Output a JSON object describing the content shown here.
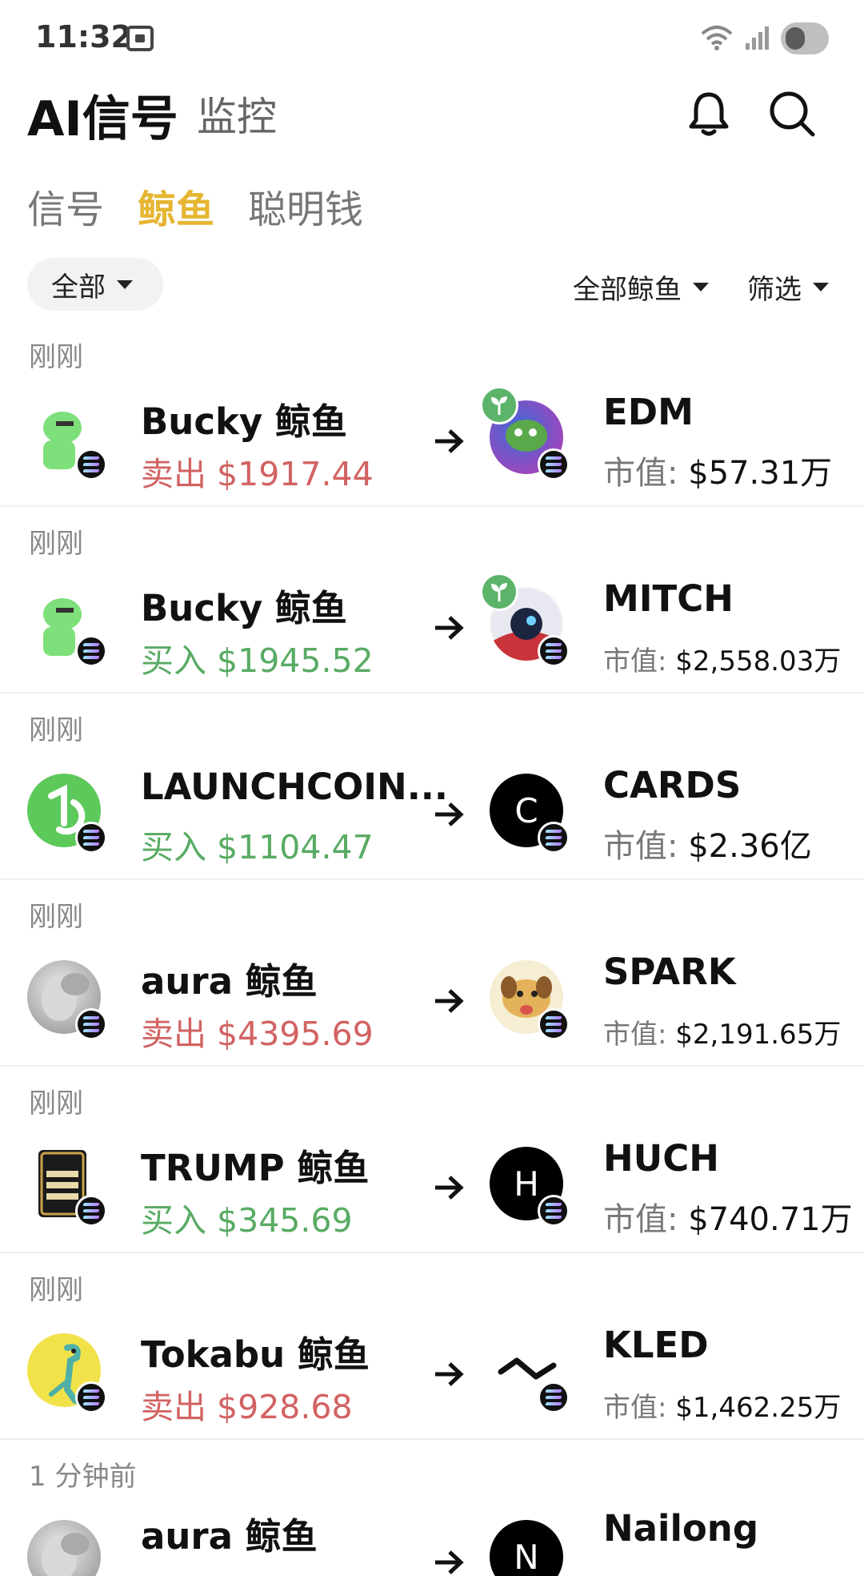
{
  "status": {
    "time": "11:32"
  },
  "header": {
    "title": "AI信号",
    "monitor": "监控"
  },
  "tabs": [
    {
      "label": "信号",
      "active": false
    },
    {
      "label": "鲸鱼",
      "active": true
    },
    {
      "label": "聪明钱",
      "active": false
    }
  ],
  "filters": {
    "all": "全部",
    "whales": "全部鲸鱼",
    "screen": "筛选"
  },
  "colors": {
    "accent": "#e5b632",
    "sell": "#d26262",
    "buy": "#58ab63"
  },
  "mcap_label": "市值:",
  "items": [
    {
      "time": "刚刚",
      "whale": "Bucky 鲸鱼",
      "action": "卖出",
      "amount": "$1917.44",
      "side": "sell",
      "token": "EDM",
      "mcap": "$57.31万",
      "seed": true,
      "avatar_icon": "pepe-avatar-icon",
      "token_icon": "edm-token-icon"
    },
    {
      "time": "刚刚",
      "whale": "Bucky 鲸鱼",
      "action": "买入",
      "amount": "$1945.52",
      "side": "buy",
      "token": "MITCH",
      "mcap": "$2,558.03万",
      "seed": true,
      "avatar_icon": "pepe-avatar-icon",
      "token_icon": "mitch-token-icon"
    },
    {
      "time": "刚刚",
      "whale": "LAUNCHCOIN...",
      "action": "买入",
      "amount": "$1104.47",
      "side": "buy",
      "token": "CARDS",
      "mcap": "$2.36亿",
      "seed": false,
      "avatar_icon": "launchcoin-avatar-icon",
      "token_letter": "C"
    },
    {
      "time": "刚刚",
      "whale": "aura 鲸鱼",
      "action": "卖出",
      "amount": "$4395.69",
      "side": "sell",
      "token": "SPARK",
      "mcap": "$2,191.65万",
      "seed": false,
      "avatar_icon": "aura-avatar-icon",
      "token_icon": "spark-token-icon"
    },
    {
      "time": "刚刚",
      "whale": "TRUMP 鲸鱼",
      "action": "买入",
      "amount": "$345.69",
      "side": "buy",
      "token": "HUCH",
      "mcap": "$740.71万",
      "seed": false,
      "avatar_icon": "trump-avatar-icon",
      "token_letter": "H"
    },
    {
      "time": "刚刚",
      "whale": "Tokabu 鲸鱼",
      "action": "卖出",
      "amount": "$928.68",
      "side": "sell",
      "token": "KLED",
      "mcap": "$1,462.25万",
      "seed": false,
      "avatar_icon": "tokabu-avatar-icon",
      "token_icon": "kled-token-icon"
    },
    {
      "time": "1 分钟前",
      "whale": "aura 鲸鱼",
      "action": "",
      "amount": "",
      "side": "sell",
      "token": "Nailong",
      "mcap": "",
      "seed": false,
      "avatar_icon": "aura-avatar-icon",
      "token_letter": "N"
    }
  ]
}
